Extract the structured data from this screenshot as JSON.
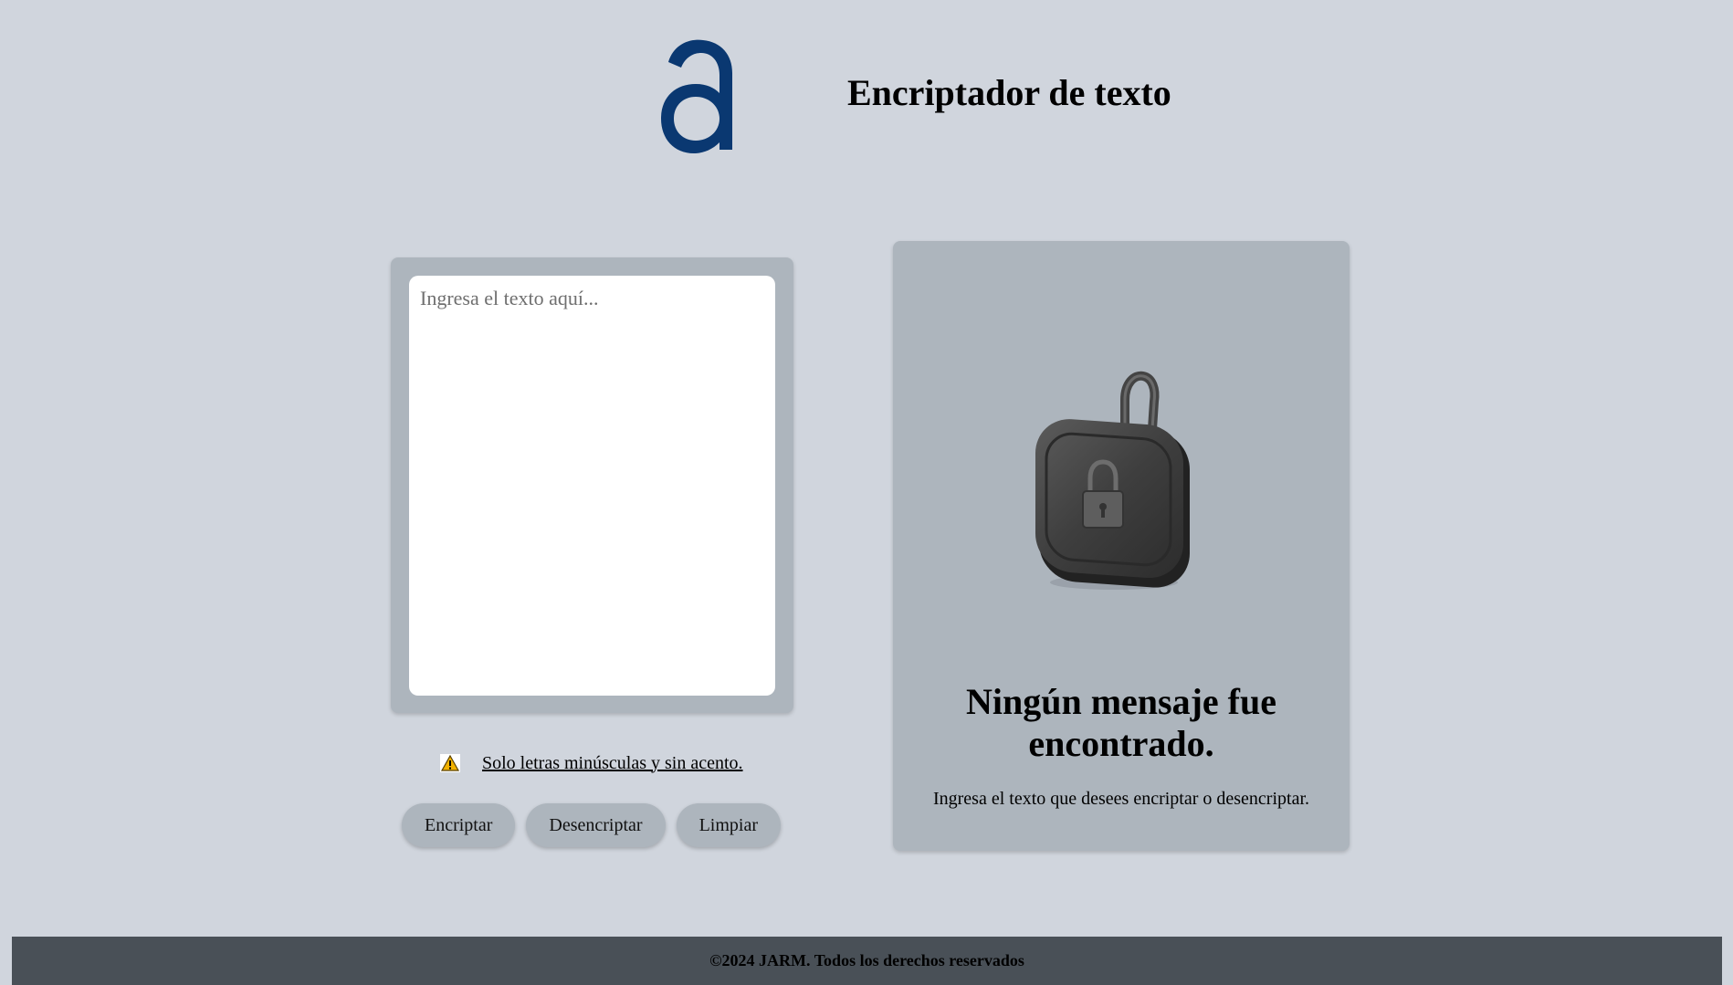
{
  "header": {
    "logo_icon": "letter-a-logo",
    "title": "Encriptador de texto"
  },
  "input": {
    "placeholder": "Ingresa el texto aquí..."
  },
  "notice": {
    "icon": "warning-icon",
    "text": "Solo letras minúsculas y sin acento."
  },
  "buttons": {
    "encrypt": "Encriptar",
    "decrypt": "Desencriptar",
    "clear": "Limpiar"
  },
  "output": {
    "image_icon": "padlock-illustration",
    "title": "Ningún mensaje fue encontrado.",
    "description": "Ingresa el texto que desees encriptar o desencriptar."
  },
  "footer": {
    "text": "©2024 JARM. Todos los derechos reservados"
  },
  "colors": {
    "background": "#d0d5dd",
    "card": "#adb5bd",
    "logo": "#0a3871",
    "footer": "#495057"
  }
}
